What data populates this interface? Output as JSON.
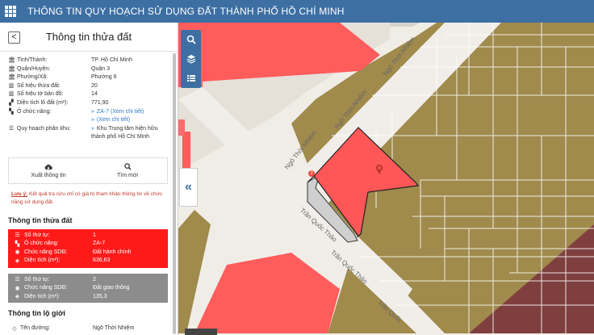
{
  "header": {
    "app_title": "THÔNG TIN QUY HOẠCH SỬ DỤNG ĐẤT THÀNH PHỐ HỒ CHÍ MINH",
    "menu_icon": "grid-icon",
    "bg_color": "#3d6fa3"
  },
  "panel": {
    "back_label": "<",
    "title": "Thông tin thửa đất",
    "info": [
      {
        "icon": "bank-icon",
        "label": "Tỉnh/Thành:",
        "value": "TP. Hồ Chí Minh"
      },
      {
        "icon": "bank-icon",
        "label": "Quận/Huyện:",
        "value": "Quận 3"
      },
      {
        "icon": "bank-icon",
        "label": "Phường/Xã:",
        "value": "Phường 6"
      },
      {
        "icon": "map-icon",
        "label": "Số hiệu thửa đất:",
        "value": "20"
      },
      {
        "icon": "map-icon",
        "label": "Số hiệu tờ bản đồ:",
        "value": "14"
      },
      {
        "icon": "area-icon",
        "label": "Diện tích lô đất (m²):",
        "value": "771,90"
      }
    ],
    "function_label": "Ô chức năng:",
    "function_links": [
      "ZA-7 (Xem chi tiết)",
      "(Xem chi tiết)"
    ],
    "zoning_label": "Quy hoạch phân khu:",
    "zoning_value": "Khu Trung tâm hiện hữu thành phố Hồ Chí Minh",
    "actions": {
      "export_label": "Xuất thông tin",
      "search_label": "Tìm mới"
    },
    "note": {
      "prefix": "Lưu ý:",
      "text": " Kết quả tra cứu chỉ có giá trị tham khảo thông tin về chức năng sử dụng đất."
    },
    "section_parcel": "Thông tin thửa đất",
    "card1": {
      "color": "#ff1a1a",
      "rows": [
        {
          "label": "Số thứ tự:",
          "value": "1"
        },
        {
          "label": "Ô chức năng:",
          "value": "ZA-7"
        },
        {
          "label": "Chức năng SDĐ:",
          "value": "Đất hành chính"
        },
        {
          "label": "Diện tích (m²):",
          "value": "636,63"
        }
      ]
    },
    "card2": {
      "color": "#8c8c8c",
      "rows": [
        {
          "label": "Số thứ tự:",
          "value": "2"
        },
        {
          "label": "Chức năng SDĐ:",
          "value": "Đất giao thông"
        },
        {
          "label": "Diện tích (m²):",
          "value": "135,3"
        }
      ]
    },
    "section_road": "Thông tin lộ giới",
    "road": {
      "label": "Tên đường:",
      "value": "Ngô Thời Nhiệm"
    }
  },
  "map": {
    "colors": {
      "land": "#a08a4c",
      "road": "#f2efe9",
      "admin": "#ff4d4d",
      "brown": "#7f3f3f",
      "selected": "#ff5757"
    },
    "street_labels": [
      "Ngô Thời Nhiệm",
      "Ngô Thời Nhiệm",
      "Ngô Thời Nhiệm",
      "Trần Quốc Thảo",
      "Trần Quốc Thảo",
      "Trần Quốc"
    ],
    "marker_1": "1",
    "marker_2": "2",
    "tools": [
      "search-icon",
      "layers-icon",
      "list-icon"
    ],
    "collapse_label": "«"
  }
}
